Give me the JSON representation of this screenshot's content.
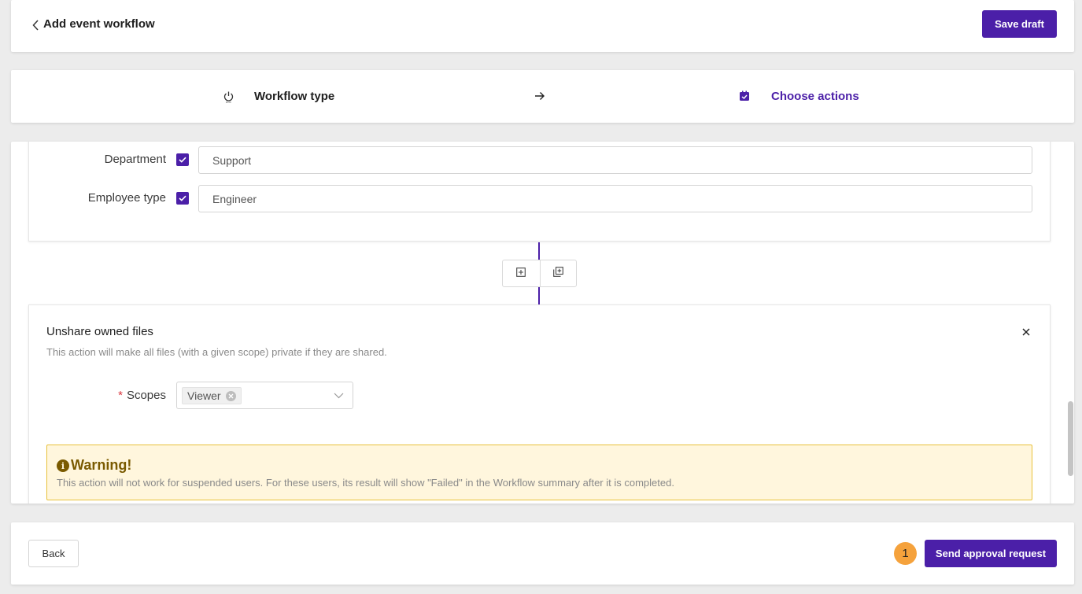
{
  "header": {
    "back_icon": "chevron-left-icon",
    "title": "Add event workflow",
    "save_label": "Save draft"
  },
  "steps": [
    {
      "label": "Workflow type",
      "icon": "power-icon",
      "active": false
    },
    {
      "label": "Choose actions",
      "icon": "actions-icon",
      "active": true
    }
  ],
  "conditions": {
    "fields": [
      {
        "label": "Department",
        "checked": true,
        "value": "Support"
      },
      {
        "label": "Employee type",
        "checked": true,
        "value": "Engineer"
      }
    ]
  },
  "add_buttons": {
    "add_action_icon": "plus-square-icon",
    "add_multiple_icon": "copy-plus-icon"
  },
  "action": {
    "title": "Unshare owned files",
    "description": "This action will make all files (with a given scope) private if they are shared.",
    "scopes_label": "Scopes",
    "required_mark": "*",
    "scopes_selected": [
      "Viewer"
    ],
    "warning": {
      "title": "Warning!",
      "text": "This action will not work for suspended users. For these users, its result will show \"Failed\" in the Workflow summary after it is completed."
    }
  },
  "footer": {
    "back_label": "Back",
    "badge_count": "1",
    "send_label": "Send approval request"
  },
  "colors": {
    "primary": "#4b1fa8",
    "badge": "#f5a23c",
    "warning_bg": "#fff6dd",
    "warning_border": "#e8c13a"
  }
}
